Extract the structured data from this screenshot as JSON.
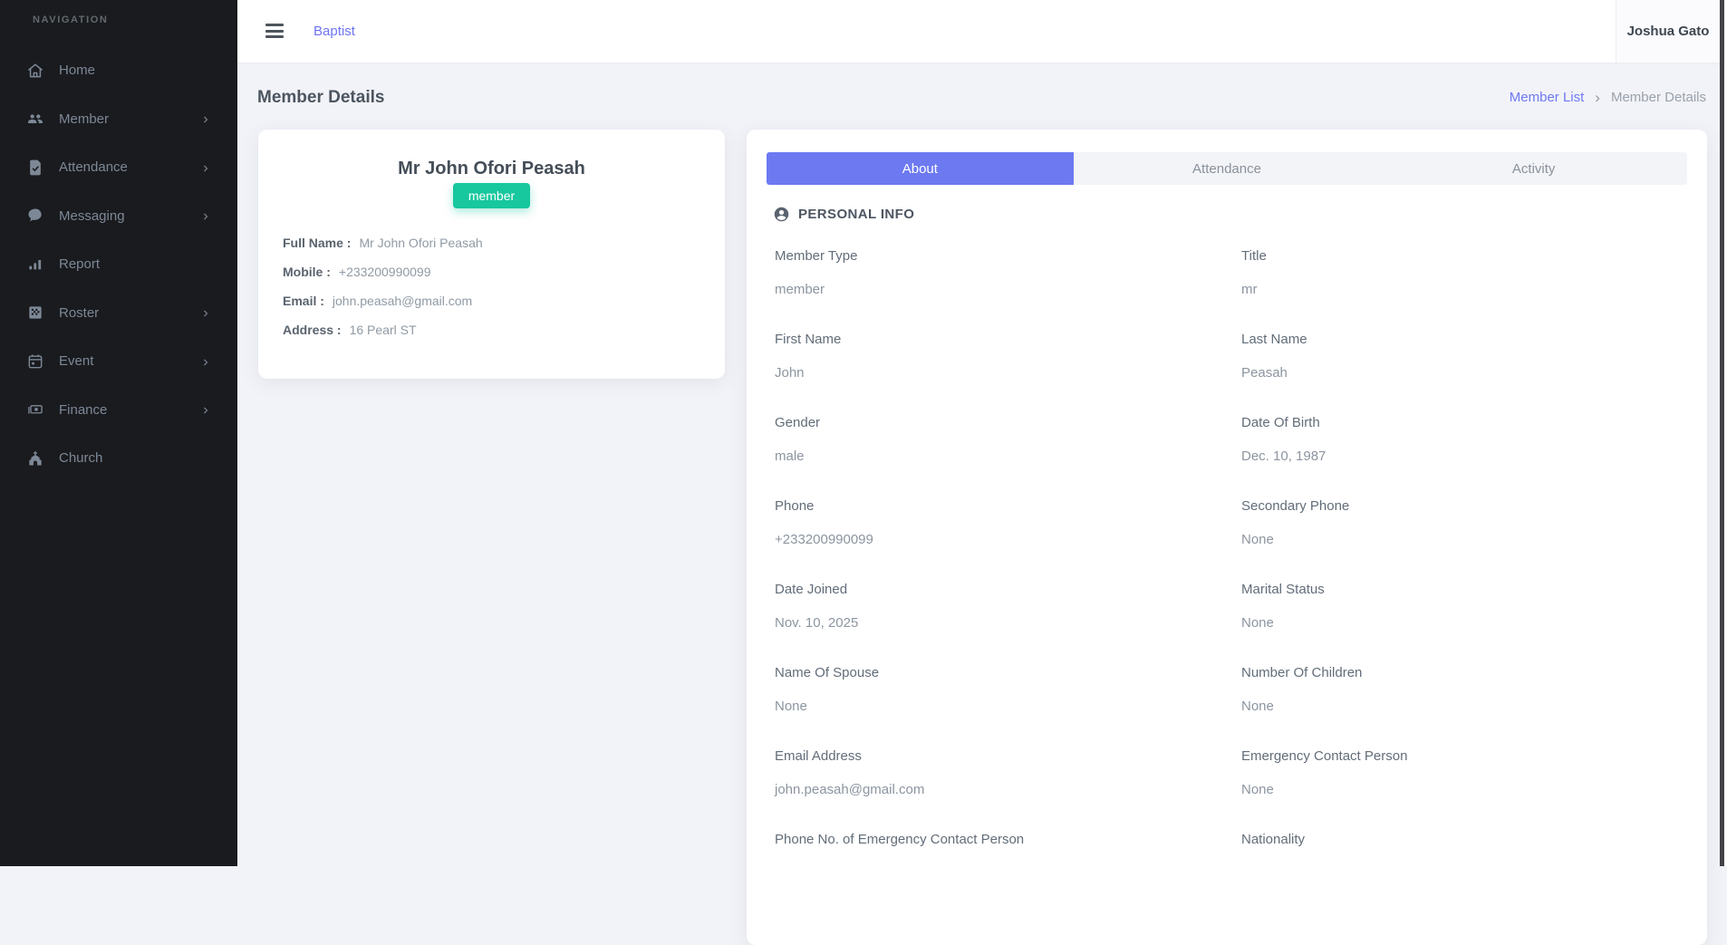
{
  "colors": {
    "accent": "#6c79f1",
    "badge_green": "#17c79d",
    "sidebar_bg": "#1a1b1e",
    "page_bg": "#f2f3f8"
  },
  "sidebar": {
    "nav_label": "NAVIGATION",
    "items": [
      {
        "label": "Home",
        "icon": "home-icon",
        "has_submenu": false
      },
      {
        "label": "Member",
        "icon": "members-icon",
        "has_submenu": true
      },
      {
        "label": "Attendance",
        "icon": "attendance-icon",
        "has_submenu": true
      },
      {
        "label": "Messaging",
        "icon": "messaging-icon",
        "has_submenu": true
      },
      {
        "label": "Report",
        "icon": "report-icon",
        "has_submenu": false
      },
      {
        "label": "Roster",
        "icon": "roster-icon",
        "has_submenu": true
      },
      {
        "label": "Event",
        "icon": "event-icon",
        "has_submenu": true
      },
      {
        "label": "Finance",
        "icon": "finance-icon",
        "has_submenu": true
      },
      {
        "label": "Church",
        "icon": "church-icon",
        "has_submenu": false
      }
    ]
  },
  "topbar": {
    "brand": "Baptist",
    "user": "Joshua Gato"
  },
  "page": {
    "title": "Member Details",
    "breadcrumb": {
      "link": "Member List",
      "separator": "›",
      "current": "Member Details"
    }
  },
  "profile": {
    "name": "Mr John Ofori Peasah",
    "badge": "member",
    "fields": [
      {
        "label": "Full Name :",
        "value": "Mr John Ofori Peasah"
      },
      {
        "label": "Mobile :",
        "value": "+233200990099"
      },
      {
        "label": "Email :",
        "value": "john.peasah@gmail.com"
      },
      {
        "label": "Address :",
        "value": "16 Pearl ST"
      }
    ]
  },
  "tabs": [
    {
      "label": "About",
      "active": true
    },
    {
      "label": "Attendance",
      "active": false
    },
    {
      "label": "Activity",
      "active": false
    }
  ],
  "personal_info": {
    "section_title": "PERSONAL INFO",
    "fields": [
      {
        "label": "Member Type",
        "value": "member"
      },
      {
        "label": "Title",
        "value": "mr"
      },
      {
        "label": "First Name",
        "value": "John"
      },
      {
        "label": "Last Name",
        "value": "Peasah"
      },
      {
        "label": "Gender",
        "value": "male"
      },
      {
        "label": "Date Of Birth",
        "value": "Dec. 10, 1987"
      },
      {
        "label": "Phone",
        "value": "+233200990099"
      },
      {
        "label": "Secondary Phone",
        "value": "None"
      },
      {
        "label": "Date Joined",
        "value": "Nov. 10, 2025"
      },
      {
        "label": "Marital Status",
        "value": "None"
      },
      {
        "label": "Name Of Spouse",
        "value": "None"
      },
      {
        "label": "Number Of Children",
        "value": "None"
      },
      {
        "label": "Email Address",
        "value": "john.peasah@gmail.com"
      },
      {
        "label": "Emergency Contact Person",
        "value": "None"
      },
      {
        "label": "Phone No. of Emergency Contact Person",
        "value": ""
      },
      {
        "label": "Nationality",
        "value": ""
      }
    ]
  }
}
